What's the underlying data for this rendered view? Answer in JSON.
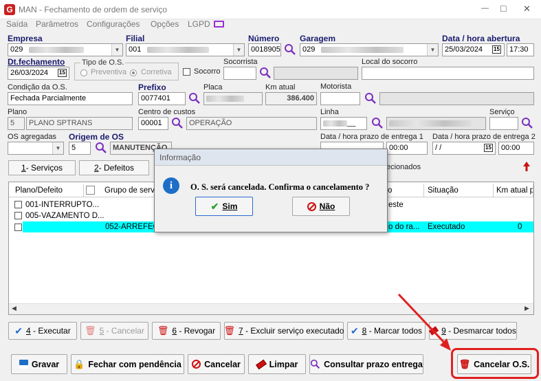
{
  "window": {
    "title": "MAN - Fechamento de ordem de serviço",
    "min": "—",
    "max": "□",
    "close": "✕"
  },
  "menu": [
    "Saída",
    "Parâmetros",
    "Configurações",
    "Opções",
    "LGPD"
  ],
  "form": {
    "empresa_label": "Empresa",
    "empresa_value": "029",
    "filial_label": "Filial",
    "filial_value": "001",
    "numero_label": "Número",
    "numero_value": "0018905",
    "garagem_label": "Garagem",
    "garagem_value": "029",
    "abertura_label": "Data / hora abertura",
    "abertura_date": "25/03/2024",
    "abertura_time": "17:30",
    "fechamento_label": "Dt.fechamento",
    "fechamento_date": "26/03/2024",
    "tipo_label": "Tipo de O.S.",
    "tipo_opt1": "Preventiva",
    "tipo_opt2": "Corretiva",
    "socorro_label": "Socorro",
    "socorrista_label": "Socorrista",
    "local_label": "Local do socorro",
    "condicao_label": "Condição da O.S.",
    "condicao_value": "Fechada Parcialmente",
    "prefixo_label": "Prefixo",
    "prefixo_value": "0077401",
    "placa_label": "Placa",
    "km_label": "Km atual",
    "km_value": "386.400",
    "motorista_label": "Motorista",
    "plano_label": "Plano",
    "plano_code": "5",
    "plano_value": "PLANO SPTRANS",
    "centro_label": "Centro de custos",
    "centro_code": "00001",
    "centro_value": "OPERAÇÃO",
    "linha_label": "Linha",
    "servico_label": "Serviço",
    "agregadas_label": "OS agregadas",
    "origem_label": "Origem de OS",
    "origem_code": "5",
    "origem_value": "MANUTENÇÃO",
    "prazo1_label": "Data / hora prazo de entrega 1",
    "prazo1_time": "00:00",
    "prazo2_label": "Data / hora prazo de entrega 2",
    "prazo2_date": " /  /",
    "prazo2_time": "00:00"
  },
  "tabs": [
    {
      "key": "1",
      "rest": " - Serviços"
    },
    {
      "key": "2",
      "rest": " - Defeitos"
    }
  ],
  "selecionados": "ecionados",
  "grid": {
    "headers": [
      "Plano/Defeito",
      "Grupo de servio",
      "o",
      "Situação",
      "Km atual pl"
    ],
    "rows": [
      {
        "col1": "001-INTERRUPTO...",
        "col2": "",
        "col3": "este",
        "col4": "",
        "col5": ""
      },
      {
        "col1": "005-VAZAMENTO D...",
        "col2": "",
        "col3": "",
        "col4": "",
        "col5": ""
      },
      {
        "col1": "",
        "col2": "052-ARREFEC",
        "col3": "o do ra...",
        "col4": "Executado",
        "col5": "0"
      }
    ]
  },
  "action_buttons": [
    {
      "key": "4",
      "rest": " - Executar"
    },
    {
      "key": "5",
      "rest": " - Cancelar"
    },
    {
      "key": "6",
      "rest": " - Revogar"
    },
    {
      "key": "7",
      "rest": " - Excluir serviço executado"
    },
    {
      "key": "8",
      "rest": " - Marcar todos"
    },
    {
      "key": "9",
      "rest": " - Desmarcar todos"
    }
  ],
  "bottom_buttons": {
    "gravar": "Gravar",
    "pendencia": "Fechar com pendência",
    "cancelar": "Cancelar",
    "limpar": "Limpar",
    "consultar": "Consultar prazo entrega",
    "cancelar_os": "Cancelar O.S."
  },
  "dialog": {
    "title": "Informação",
    "message": "O. S. será cancelada. Confirma o cancelamento ?",
    "yes": "Sim",
    "no": "Não"
  },
  "colors": {
    "highlight_row": "#00ffff",
    "accent": "#7b2fbf",
    "annotation": "#e02020"
  }
}
